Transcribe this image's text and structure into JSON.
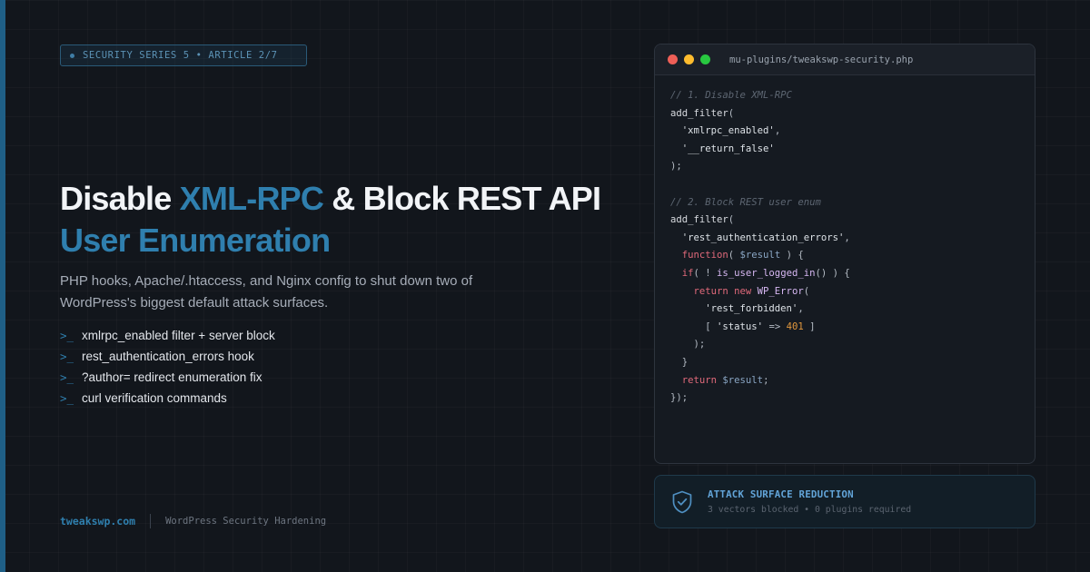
{
  "badge": "SECURITY SERIES 5 • ARTICLE 2/7",
  "title": {
    "part1": "Disable ",
    "highlight1": "XML-RPC",
    "part2": " & Block REST API",
    "line2": "User Enumeration"
  },
  "description": "PHP hooks, Apache/.htaccess, and Nginx config to shut down two of WordPress's biggest default attack surfaces.",
  "features": [
    {
      "prompt": ">_",
      "text": "xmlrpc_enabled filter + server block"
    },
    {
      "prompt": ">_",
      "text": "rest_authentication_errors hook"
    },
    {
      "prompt": ">_",
      "text": "?author= redirect enumeration fix"
    },
    {
      "prompt": ">_",
      "text": "curl verification commands"
    }
  ],
  "footer": {
    "site": "tweakswp.com",
    "tagline": "WordPress Security Hardening"
  },
  "code_window": {
    "filename": "mu-plugins/tweakswp-security.php",
    "traffic_lights": [
      "#ef5f57",
      "#febc2e",
      "#28c840"
    ],
    "lines": [
      [
        {
          "t": "// 1. Disable XML-RPC",
          "c": "com"
        }
      ],
      [
        {
          "t": "add_filter",
          "c": "fn"
        },
        {
          "t": "(",
          "c": "pun"
        }
      ],
      [
        {
          "t": "  'xmlrpc_enabled'",
          "c": "str"
        },
        {
          "t": ",",
          "c": "pun"
        }
      ],
      [
        {
          "t": "  '__return_false'",
          "c": "str"
        }
      ],
      [
        {
          "t": ");",
          "c": "pun"
        }
      ],
      [
        {
          "t": "",
          "c": "pun"
        }
      ],
      [
        {
          "t": "// 2. Block REST user enum",
          "c": "com"
        }
      ],
      [
        {
          "t": "add_filter",
          "c": "fn"
        },
        {
          "t": "(",
          "c": "pun"
        }
      ],
      [
        {
          "t": "  'rest_authentication_errors'",
          "c": "str"
        },
        {
          "t": ",",
          "c": "pun"
        }
      ],
      [
        {
          "t": "  function",
          "c": "kw"
        },
        {
          "t": "( ",
          "c": "pun"
        },
        {
          "t": "$result",
          "c": "var"
        },
        {
          "t": " ) {",
          "c": "pun"
        }
      ],
      [
        {
          "t": "  if",
          "c": "kw"
        },
        {
          "t": "( ! ",
          "c": "pun"
        },
        {
          "t": "is_user_logged_in",
          "c": "call"
        },
        {
          "t": "() ) {",
          "c": "pun"
        }
      ],
      [
        {
          "t": "    return new ",
          "c": "kw"
        },
        {
          "t": "WP_Error",
          "c": "call"
        },
        {
          "t": "(",
          "c": "pun"
        }
      ],
      [
        {
          "t": "      'rest_forbidden'",
          "c": "str"
        },
        {
          "t": ",",
          "c": "pun"
        }
      ],
      [
        {
          "t": "      [ ",
          "c": "pun"
        },
        {
          "t": "'status'",
          "c": "str"
        },
        {
          "t": " => ",
          "c": "pun"
        },
        {
          "t": "401",
          "c": "num"
        },
        {
          "t": " ]",
          "c": "pun"
        }
      ],
      [
        {
          "t": "    );",
          "c": "pun"
        }
      ],
      [
        {
          "t": "  }",
          "c": "pun"
        }
      ],
      [
        {
          "t": "  return ",
          "c": "kw"
        },
        {
          "t": "$result",
          "c": "var"
        },
        {
          "t": ";",
          "c": "pun"
        }
      ],
      [
        {
          "t": "});",
          "c": "pun"
        }
      ]
    ]
  },
  "surface_card": {
    "title": "ATTACK SURFACE REDUCTION",
    "subtitle": "3 vectors blocked • 0 plugins required",
    "icon": "shield-check-icon"
  },
  "colors": {
    "accent": "#2f7fae",
    "background": "#12161c"
  }
}
